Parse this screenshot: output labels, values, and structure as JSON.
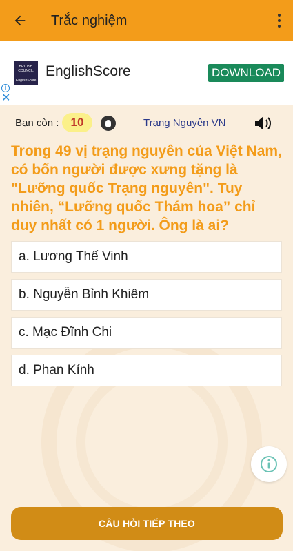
{
  "appbar": {
    "title": "Trắc nghiệm",
    "back_icon": "arrow-left-icon",
    "menu_icon": "more-vert-icon",
    "color": "#f39c1a"
  },
  "ad": {
    "brand_line1": "BRITISH COUNCIL",
    "brand_line2": "EnglishScore",
    "name": "EnglishScore",
    "cta": "DOWNLOAD",
    "cta_color": "#1a8a5a"
  },
  "status": {
    "remaining_label": "Bạn còn :",
    "remaining_count": "10",
    "topic": "Trạng Nguyên VN"
  },
  "question": {
    "text": "Trong 49 vị trạng nguyên của Việt Nam, có bốn người được xưng tặng là \"Lưỡng quốc Trạng nguyên\". Tuy nhiên, “Lưỡng quốc Thám hoa” chỉ duy nhất có 1 người. Ông là ai?",
    "color": "#f39c1a"
  },
  "answers": [
    {
      "label": "a. Lương Thế Vinh"
    },
    {
      "label": "b. Nguyễn Bỉnh Khiêm"
    },
    {
      "label": "c. Mạc Đĩnh Chi"
    },
    {
      "label": "d. Phan Kính"
    }
  ],
  "next_button": {
    "label": "CÂU HỎI TIẾP THEO",
    "color": "#d18c16"
  }
}
